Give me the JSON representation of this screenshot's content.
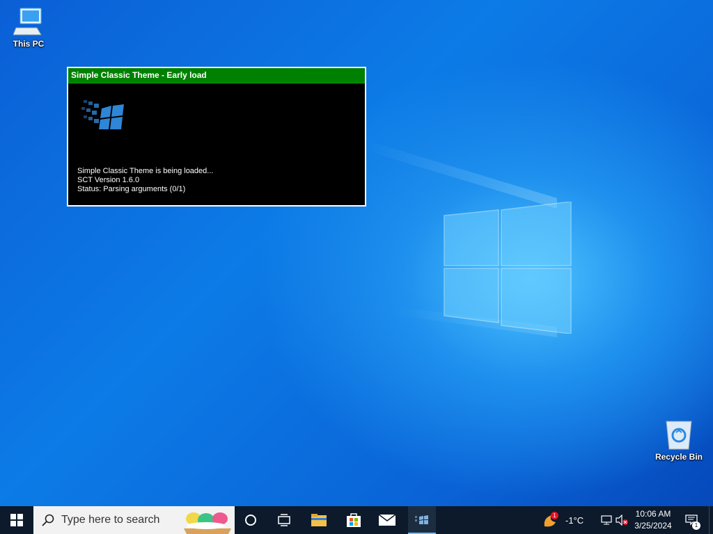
{
  "desktop": {
    "icons": [
      {
        "label": "This PC",
        "icon": "computer-icon"
      },
      {
        "label": "Recycle Bin",
        "icon": "recycle-bin-icon"
      }
    ]
  },
  "sct_window": {
    "title": "Simple Classic Theme - Early load",
    "lines": [
      "Simple Classic Theme is being loaded...",
      "SCT Version 1.6.0",
      "Status: Parsing arguments (0/1)"
    ],
    "title_color": "#008000"
  },
  "taskbar": {
    "search_placeholder": "Type here to search",
    "weather": {
      "temp": "-1°C",
      "badge": "1"
    },
    "clock": {
      "time": "10:06 AM",
      "date": "3/25/2024"
    },
    "notification_badge": "1",
    "apps": [
      "start-icon",
      "search-icon",
      "cortana-icon",
      "task-view-icon",
      "file-explorer-icon",
      "store-icon",
      "mail-icon",
      "sct-app-icon"
    ]
  }
}
